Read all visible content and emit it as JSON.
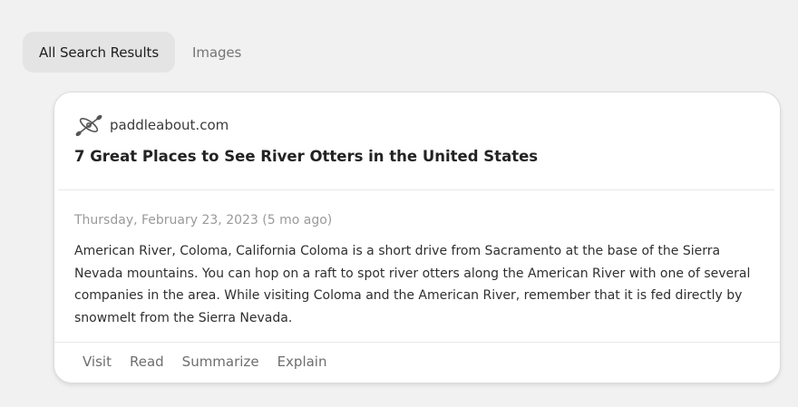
{
  "tabs": [
    {
      "label": "All Search Results",
      "active": true
    },
    {
      "label": "Images",
      "active": false
    }
  ],
  "result": {
    "source_icon": "kayak-paddle-icon",
    "domain": "paddleabout.com",
    "title": "7 Great Places to See River Otters in the United States",
    "date": "Thursday, February 23, 2023 (5 mo ago)",
    "snippet": "American River, Coloma, California Coloma is a short drive from Sacramento at the base of the Sierra Nevada mountains. You can hop on a raft to spot river otters along the American River with one of several companies in the area. While visiting Coloma and the American River, remember that it is fed directly by snowmelt from the Sierra Nevada.",
    "actions": {
      "visit": "Visit",
      "read": "Read",
      "summarize": "Summarize",
      "explain": "Explain"
    }
  },
  "colors": {
    "background": "#f1f1f1",
    "active_tab": "#e4e4e4",
    "card": "#ffffff",
    "muted_text": "#9a9a9a"
  }
}
